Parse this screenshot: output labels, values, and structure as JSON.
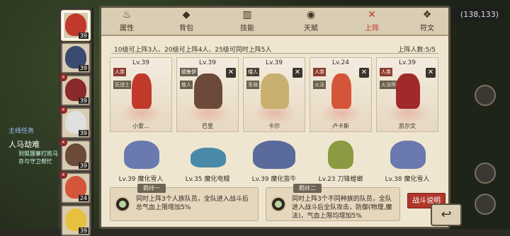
{
  "coords": "(138,133)",
  "quest": {
    "label": "主线任务",
    "title": "人马劫难",
    "sub": "到狐狸寨打败马亦与守卫帮忙"
  },
  "tabs": [
    {
      "label": "属性",
      "icon": "flame-icon"
    },
    {
      "label": "背包",
      "icon": "bag-icon"
    },
    {
      "label": "技能",
      "icon": "book-icon"
    },
    {
      "label": "天赋",
      "icon": "eye-icon"
    },
    {
      "label": "上阵",
      "icon": "swords-icon"
    },
    {
      "label": "符文",
      "icon": "rune-icon"
    }
  ],
  "info": "10级可上阵3人、20级可上阵4人、25级可同时上阵5人",
  "count": "上阵人数:5/5",
  "roster": [
    "39",
    "39",
    "39",
    "39",
    "39",
    "24",
    "39"
  ],
  "heroes": [
    {
      "lv": "Lv.39",
      "race": "人类",
      "role": "狂战士",
      "name": "小爱...",
      "color": "#c0392b"
    },
    {
      "lv": "Lv.39",
      "race": "德鲁伊",
      "role": "敖人",
      "name": "巴里",
      "color": "#6b4a3a"
    },
    {
      "lv": "Lv.39",
      "race": "矮人",
      "role": "圣骑",
      "name": "卡尔",
      "color": "#c8b070"
    },
    {
      "lv": "Lv.24",
      "race": "人类",
      "role": "火法",
      "name": "卢卡斯",
      "color": "#d4553a"
    },
    {
      "lv": "Lv.39",
      "race": "人类",
      "role": "火法师",
      "name": "凯尔文",
      "color": "#a02a2a"
    }
  ],
  "pets": [
    {
      "name": "Lv.39 魔化雪人",
      "color": "#6a7ab0"
    },
    {
      "name": "Lv.35 魔化电鳗",
      "color": "#4a8aa8"
    },
    {
      "name": "Lv.39 魔化蛮牛",
      "color": "#5a6a9a"
    },
    {
      "name": "Lv.23 刀锋螳螂",
      "color": "#8a9a40"
    },
    {
      "name": "Lv.38 魔化雪人",
      "color": "#6a7ab0"
    }
  ],
  "bonds": [
    {
      "title": "羁绊一",
      "desc": "同时上阵3个人族队员，全队进入战斗后总气血上限增加5%"
    },
    {
      "title": "羁绊二",
      "desc": "同时上阵3个不同种族的队员，全队进入战斗后全队攻击，防御(物理,魔法)，气血上限均增加5%"
    }
  ],
  "help": "战斗说明"
}
